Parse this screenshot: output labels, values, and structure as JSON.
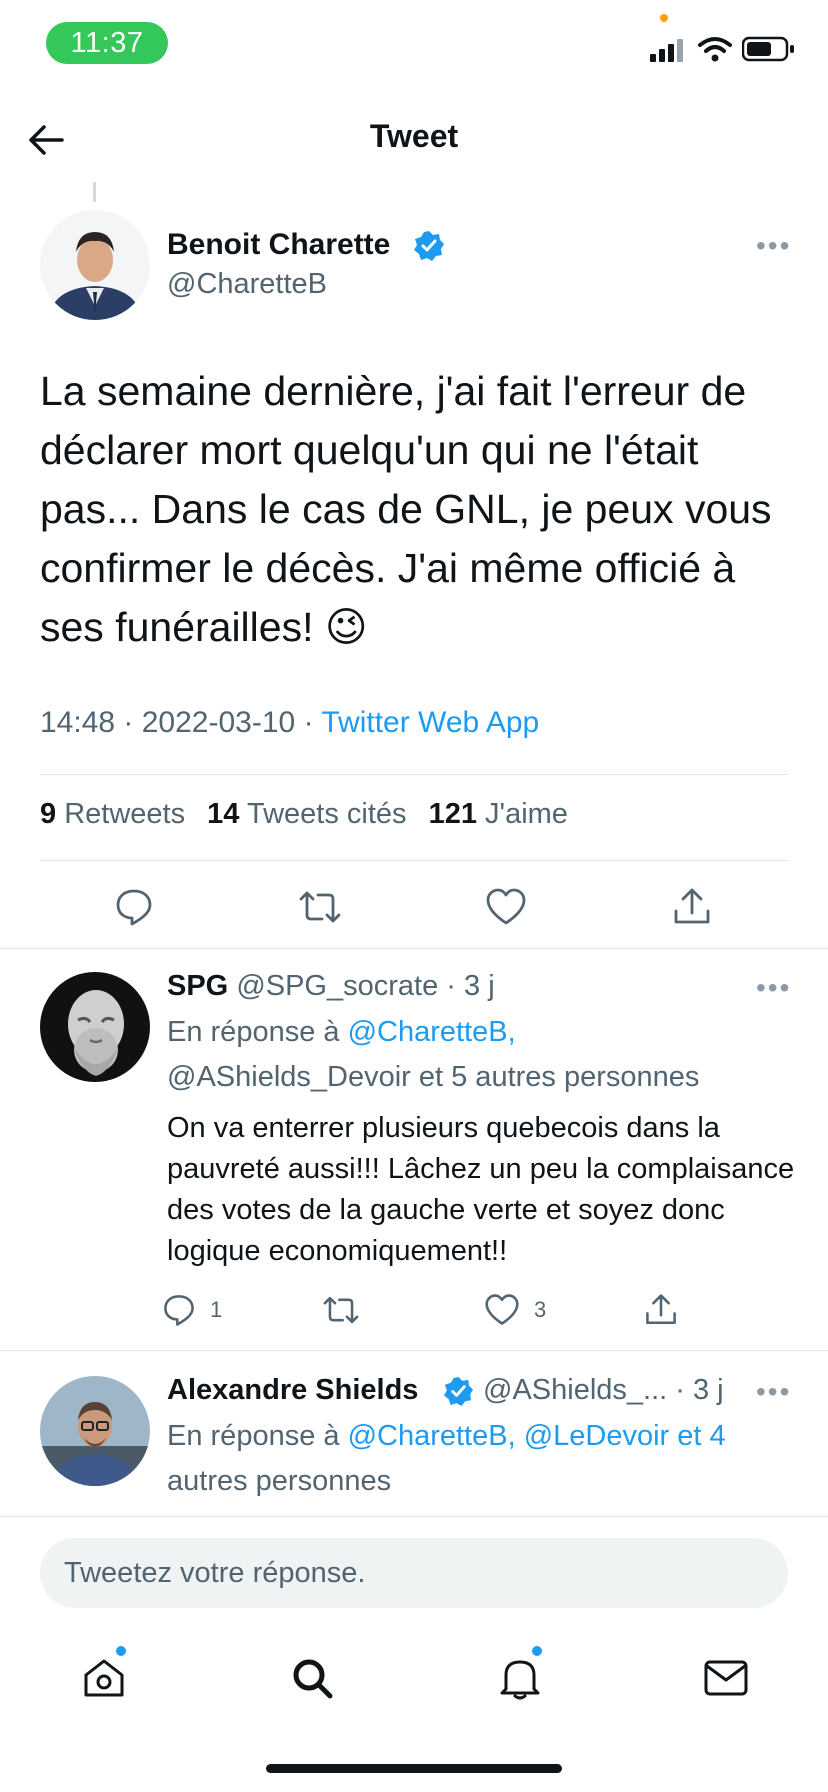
{
  "status_bar": {
    "time": "11:37"
  },
  "header": {
    "title": "Tweet"
  },
  "main_tweet": {
    "author_name": "Benoit Charette",
    "handle": "@CharetteB",
    "text": "La semaine dernière, j'ai fait l'erreur de déclarer mort quelqu'un qui ne l'était pas...  Dans le cas de GNL, je peux vous confirmer le décès.  J'ai même officié à ses funérailles! 😉",
    "time": "14:48",
    "date": "2022-03-10",
    "source": "Twitter Web App",
    "retweets_count": "9",
    "retweets_label": "Retweets",
    "quotes_count": "14",
    "quotes_label": "Tweets cités",
    "likes_count": "121",
    "likes_label": "J'aime"
  },
  "replies": [
    {
      "author_name": "SPG",
      "handle": "@SPG_socrate",
      "age": "3 j",
      "reply_prefix": "En réponse à",
      "reply_to_line1": "@CharetteB,",
      "reply_to_line2": "@AShields_Devoir et 5 autres personnes",
      "text": "On va enterrer plusieurs quebecois dans la pauvreté aussi!!! Lâchez un peu la complaisance des votes de la gauche verte et soyez donc logique  economiquement!!",
      "reply_count": "1",
      "like_count": "3"
    },
    {
      "author_name": "Alexandre Shields",
      "handle": "@AShields_...",
      "age": "3 j",
      "reply_prefix": "En réponse à",
      "reply_to_line1": "@CharetteB, @LeDevoir et 4",
      "reply_to_line2": "autres personnes"
    }
  ],
  "compose": {
    "placeholder": "Tweetez votre réponse."
  },
  "colors": {
    "accent": "#1d9bf0",
    "text": "#0f1419",
    "muted": "#536471",
    "status_pill": "#34c759"
  },
  "icons": [
    "back-arrow-icon",
    "verified-badge-icon",
    "more-icon",
    "reply-icon",
    "retweet-icon",
    "like-icon",
    "share-icon",
    "home-icon",
    "search-icon",
    "notifications-icon",
    "messages-icon",
    "signal-icon",
    "wifi-icon",
    "battery-icon"
  ]
}
